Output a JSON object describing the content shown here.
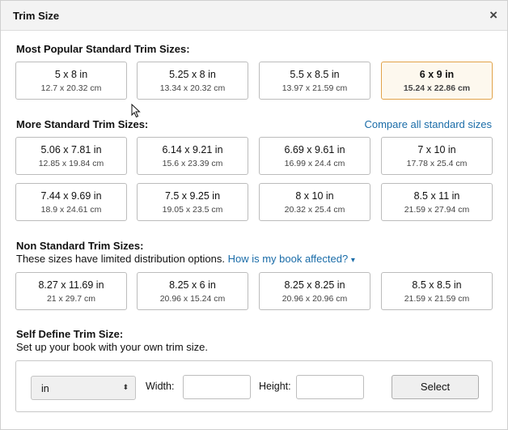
{
  "dialog": {
    "title": "Trim Size",
    "close_icon": "close-icon",
    "close_glyph": "×"
  },
  "popular": {
    "title": "Most Popular Standard Trim Sizes:",
    "items": [
      {
        "main": "5 x 8 in",
        "sub": "12.7 x 20.32 cm"
      },
      {
        "main": "5.25 x 8 in",
        "sub": "13.34 x 20.32 cm"
      },
      {
        "main": "5.5 x 8.5 in",
        "sub": "13.97 x 21.59 cm"
      },
      {
        "main": "6 x 9 in",
        "sub": "15.24 x 22.86 cm",
        "selected": true
      }
    ]
  },
  "more": {
    "title": "More Standard Trim Sizes:",
    "compare_link": "Compare all standard sizes",
    "items": [
      {
        "main": "5.06 x 7.81 in",
        "sub": "12.85 x 19.84 cm"
      },
      {
        "main": "6.14 x 9.21 in",
        "sub": "15.6 x 23.39 cm"
      },
      {
        "main": "6.69 x 9.61 in",
        "sub": "16.99 x 24.4 cm"
      },
      {
        "main": "7 x 10 in",
        "sub": "17.78 x 25.4 cm"
      },
      {
        "main": "7.44 x 9.69 in",
        "sub": "18.9 x 24.61 cm"
      },
      {
        "main": "7.5 x 9.25 in",
        "sub": "19.05 x 23.5 cm"
      },
      {
        "main": "8 x 10 in",
        "sub": "20.32 x 25.4 cm"
      },
      {
        "main": "8.5 x 11 in",
        "sub": "21.59 x 27.94 cm"
      }
    ]
  },
  "nonstandard": {
    "title": "Non Standard Trim Sizes:",
    "subtitle": "These sizes have limited distribution options.",
    "affected_link": "How is my book affected?",
    "affected_arrow": "▾",
    "items": [
      {
        "main": "8.27 x 11.69 in",
        "sub": "21 x 29.7 cm"
      },
      {
        "main": "8.25 x 6 in",
        "sub": "20.96 x 15.24 cm"
      },
      {
        "main": "8.25 x 8.25 in",
        "sub": "20.96 x 20.96 cm"
      },
      {
        "main": "8.5 x 8.5 in",
        "sub": "21.59 x 21.59 cm"
      }
    ]
  },
  "self_define": {
    "title": "Self Define Trim Size:",
    "subtitle": "Set up your book with your own trim size.",
    "unit_value": "in",
    "unit_arrow": "⬍",
    "width_label": "Width:",
    "width_value": "",
    "height_label": "Height:",
    "height_value": "",
    "select_label": "Select"
  },
  "colors": {
    "link": "#1a6ca8",
    "selected_border": "#e1a34a",
    "selected_bg": "#fdf8ee",
    "header_bg": "#f3f3f3"
  }
}
